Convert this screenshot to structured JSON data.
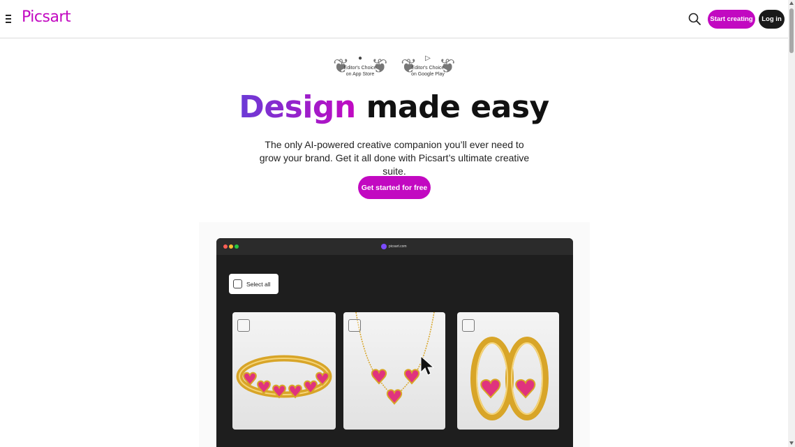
{
  "header": {
    "logo": "Picsart",
    "menu_icon": "hamburger-icon",
    "search_icon": "search-icon",
    "start_button": "Start creating",
    "login_button": "Log in"
  },
  "awards": [
    {
      "icon": "apple-icon",
      "line1": "Editor's Choice",
      "line2": "on App Store"
    },
    {
      "icon": "google-play-icon",
      "line1": "Editor's Choice",
      "line2": "on Google Play"
    }
  ],
  "hero": {
    "title_accent": "Design",
    "title_rest": " made easy",
    "subtitle": "The only AI-powered creative companion you’ll ever need to grow your brand. Get it all done with Picsart’s ultimate creative suite.",
    "cta": "Get started for free"
  },
  "preview": {
    "url": "picsart.com",
    "select_all": "Select all",
    "cards": [
      {
        "name": "ring",
        "selected": false
      },
      {
        "name": "necklace",
        "selected": false
      },
      {
        "name": "earrings",
        "selected": false
      }
    ]
  },
  "colors": {
    "brand": "#c209c1",
    "accent_gradient_start": "#6a3bd6",
    "dark": "#1a1a1a"
  }
}
